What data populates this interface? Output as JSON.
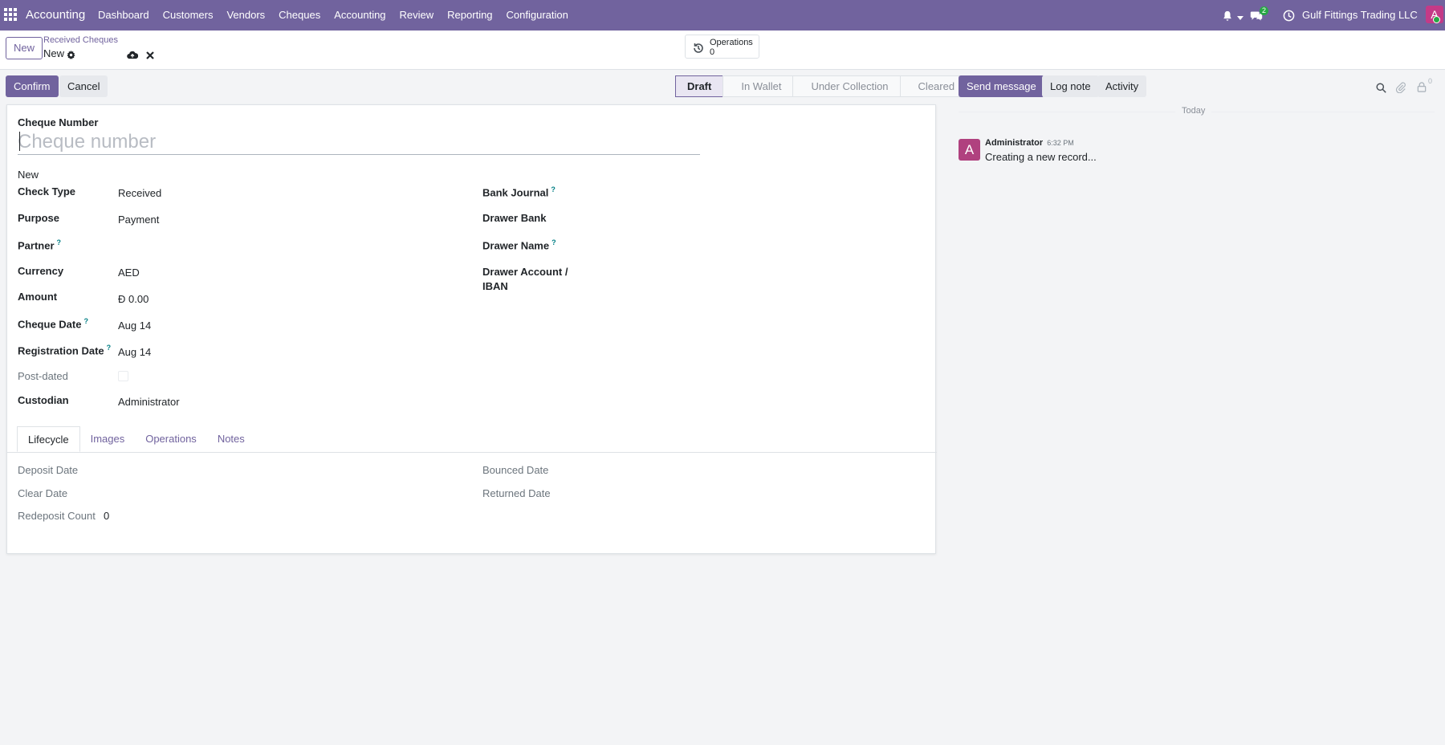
{
  "navbar": {
    "app_name": "Accounting",
    "menu": [
      "Dashboard",
      "Customers",
      "Vendors",
      "Cheques",
      "Accounting",
      "Review",
      "Reporting",
      "Configuration"
    ],
    "messages_count": "2",
    "company": "Gulf Fittings Trading LLC",
    "avatar_letter": "A",
    "colors": {
      "bar": "#71639e",
      "online": "#28a745"
    }
  },
  "control": {
    "new_button": "New",
    "breadcrumb_parent": "Received Cheques",
    "breadcrumb_current": "New",
    "smart_button_label": "Operations",
    "smart_button_value": "0"
  },
  "form_actions": {
    "confirm": "Confirm",
    "cancel": "Cancel"
  },
  "status_stages": [
    "Draft",
    "In Wallet",
    "Under Collection",
    "Cleared"
  ],
  "form": {
    "cheque_number_label": "Cheque Number",
    "cheque_number_placeholder": "Cheque number",
    "state_text": "New",
    "left_fields": {
      "check_type": {
        "label": "Check Type",
        "value": "Received"
      },
      "purpose": {
        "label": "Purpose",
        "value": "Payment"
      },
      "partner": {
        "label": "Partner",
        "value": ""
      },
      "currency": {
        "label": "Currency",
        "value": "AED"
      },
      "amount": {
        "label": "Amount",
        "value": "Đ 0.00"
      },
      "cheque_date": {
        "label": "Cheque Date",
        "value": "Aug 14"
      },
      "registration_date": {
        "label": "Registration Date",
        "value": "Aug 14"
      },
      "post_dated": {
        "label": "Post-dated",
        "value": ""
      },
      "custodian": {
        "label": "Custodian",
        "value": "Administrator"
      }
    },
    "right_fields": {
      "bank_journal": {
        "label": "Bank Journal"
      },
      "drawer_bank": {
        "label": "Drawer Bank"
      },
      "drawer_name": {
        "label": "Drawer Name"
      },
      "drawer_account_line1": "Drawer Account /",
      "drawer_account_line2": "IBAN"
    },
    "help_mark": "?",
    "tabs": [
      "Lifecycle",
      "Images",
      "Operations",
      "Notes"
    ],
    "lifecycle": {
      "deposit_date": "Deposit Date",
      "bounced_date": "Bounced Date",
      "clear_date": "Clear Date",
      "returned_date": "Returned Date",
      "redeposit_count_label": "Redeposit Count",
      "redeposit_count_value": "0"
    }
  },
  "chatter": {
    "send_message": "Send message",
    "log_note": "Log note",
    "activity": "Activity",
    "followers_count": "0",
    "date_separator": "Today",
    "message": {
      "avatar_letter": "A",
      "author": "Administrator",
      "time": "6:32 PM",
      "body": "Creating a new record..."
    }
  }
}
